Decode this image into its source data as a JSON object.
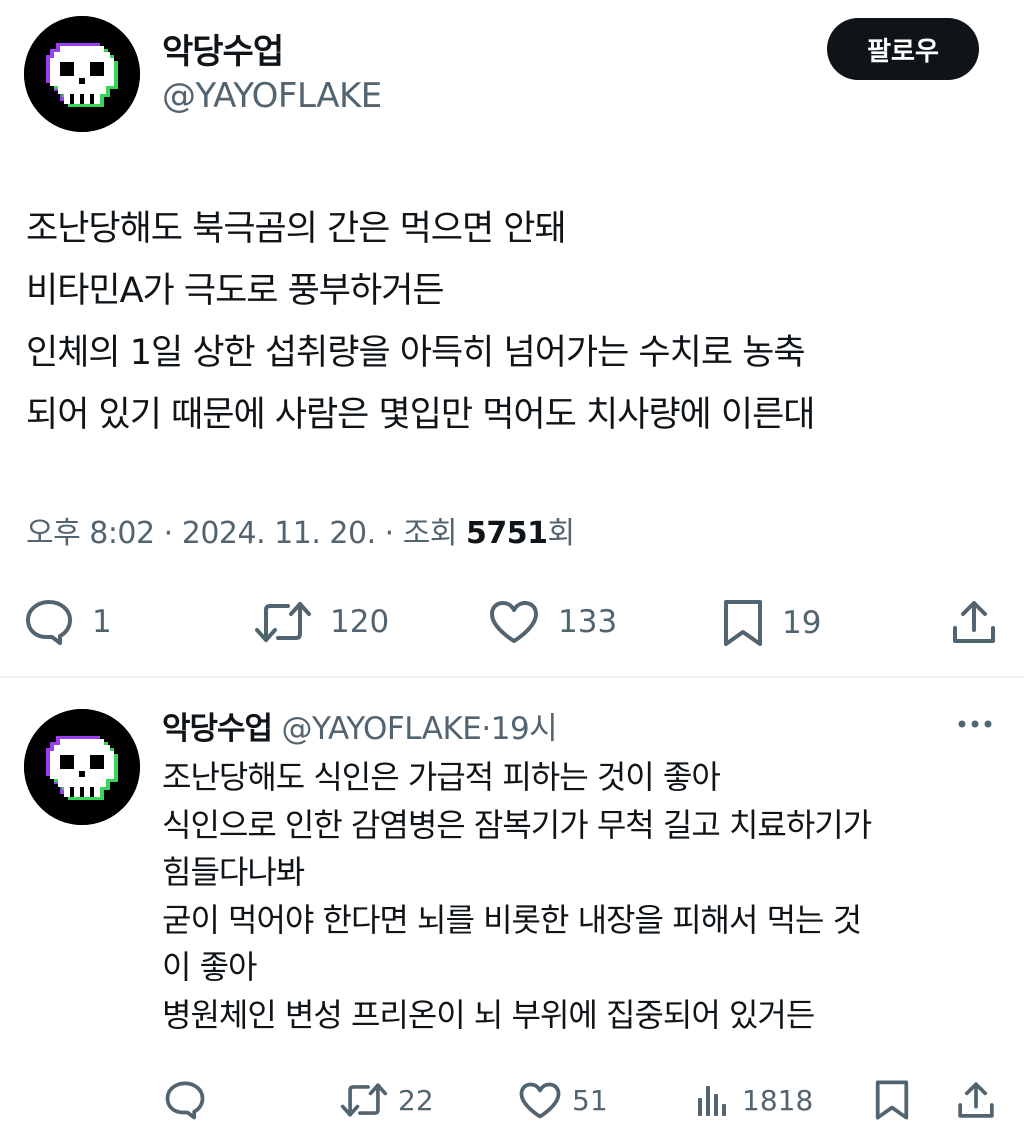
{
  "tweet": {
    "author": {
      "name": "악당수업",
      "handle": "@YAYOFLAKE"
    },
    "follow_label": "팔로우",
    "body": [
      "조난당해도 북극곰의 간은 먹으면 안돼",
      "비타민A가 극도로 풍부하거든",
      "인체의 1일 상한 섭취량을 아득히 넘어가는 수치로 농축",
      "되어 있기 때문에 사람은 몇입만 먹어도 치사량에 이른대"
    ],
    "meta": {
      "time": "오후 8:02",
      "date": "2024. 11. 20.",
      "views_label": "조회",
      "views": "5751",
      "views_suffix": "회"
    },
    "actions": {
      "replies": "1",
      "retweets": "120",
      "likes": "133",
      "bookmarks": "19"
    }
  },
  "reply": {
    "author": {
      "name": "악당수업",
      "handle": "@YAYOFLAKE",
      "time": "19시"
    },
    "body": [
      "조난당해도 식인은 가급적 피하는 것이 좋아",
      "식인으로 인한 감염병은 잠복기가 무척 길고 치료하기가",
      "힘들다나봐",
      "굳이 먹어야 한다면 뇌를 비롯한 내장을 피해서 먹는 것",
      "이 좋아",
      "병원체인 변성 프리온이 뇌 부위에 집중되어 있거든"
    ],
    "actions": {
      "retweets": "22",
      "likes": "51",
      "views": "1818"
    }
  },
  "icons": {
    "avatar": "pixel-skull-icon",
    "reply": "speech-bubble-icon",
    "retweet": "retweet-icon",
    "like": "heart-icon",
    "bookmark": "bookmark-icon",
    "share": "share-icon",
    "views": "bar-chart-icon",
    "more": "more-dots-icon"
  },
  "colors": {
    "text": "#0f1419",
    "secondary": "#536471",
    "button_bg": "#0f1419",
    "divider": "#eff3f4"
  }
}
